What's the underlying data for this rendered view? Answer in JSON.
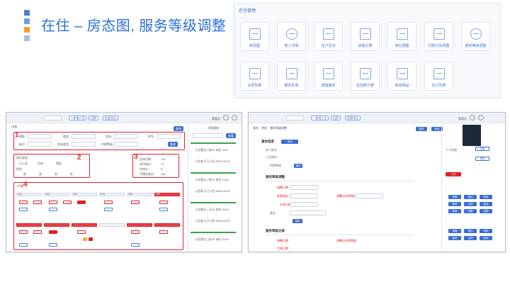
{
  "title": "在住 – 房态图, 服务等级调整",
  "management": {
    "title": "在住管理",
    "tiles": [
      {
        "label": "房态图",
        "icon": "building-icon"
      },
      {
        "label": "老人详情",
        "icon": "person-icon"
      },
      {
        "label": "住户生日",
        "icon": "cake-icon"
      },
      {
        "label": "请假记录",
        "icon": "edit-icon"
      },
      {
        "label": "床位调整",
        "icon": "bed-icon"
      },
      {
        "label": "付款计划调整",
        "icon": "chart-icon"
      },
      {
        "label": "服务等级调整",
        "icon": "medal-icon"
      },
      {
        "label": "合同列表",
        "icon": "document-icon"
      },
      {
        "label": "服务反馈",
        "icon": "feedback-icon"
      },
      {
        "label": "增值服务",
        "icon": "basket-icon"
      },
      {
        "label": "在住统计表",
        "icon": "stats-icon"
      },
      {
        "label": "房间物品",
        "icon": "house-icon"
      },
      {
        "label": "住户列表",
        "icon": "list-icon"
      }
    ]
  },
  "left_screen": {
    "top_buttons": [
      "+ 新增入住",
      "出院",
      "批量导出"
    ],
    "user": "管理员",
    "search_label": "查询",
    "filters": [
      "楼栋:",
      "楼层:",
      "状态:",
      "房号:",
      "床位:",
      "房间类型:",
      "护理等级:"
    ],
    "legend_title": "床位状态",
    "legend_items": [
      "已入住",
      "空床",
      "预定",
      "请假"
    ],
    "sex_label": "性别",
    "sex_items": [
      "男",
      "女",
      "男",
      "女"
    ],
    "stats": [
      {
        "label": "总床位数:",
        "value": "110"
      },
      {
        "label": "在住床位:",
        "value": "71"
      },
      {
        "label": "空床位:",
        "value": "8"
      },
      {
        "label": "可预定床位:",
        "value": "100"
      }
    ],
    "rooms_label": "1号楼",
    "room_numbers": [
      "101",
      "102",
      "103",
      "104",
      "105",
      "106"
    ],
    "timeline_title": "消息通知",
    "timeline_button": "查看",
    "timeline_entries": [
      "入住登记 | 张XX 床位 0101",
      "入住老人已入住 2020-03-24",
      "入住登记 | 李XX 床位 0102",
      "入住老人已入住 2020-03-23",
      "入住登记 | 王XX 床位 0103",
      "入住老人已入住 2020-03-23",
      "入住登记 | 赵XX 床位 0104"
    ],
    "callouts": [
      "1",
      "2",
      "3",
      "4"
    ]
  },
  "right_screen": {
    "tabs": [
      "服务",
      "房态",
      "服务等级调整"
    ],
    "section_titles": [
      "基本信息",
      "服务等级调整",
      "服务等级记录"
    ],
    "buttons": [
      "保存",
      "返回",
      "添加"
    ],
    "fields": [
      "老人姓名",
      "入住床位",
      "护理等级",
      "调整日期",
      "变更原因",
      "调整后护理等级",
      "生效日期",
      "备注"
    ],
    "side_title": "个人信息",
    "side_buttons": [
      "查看",
      "修改",
      "入住",
      "请假",
      "退住",
      "转床",
      "服务",
      "合同",
      "费用",
      "账单",
      "设置",
      "档案"
    ]
  }
}
